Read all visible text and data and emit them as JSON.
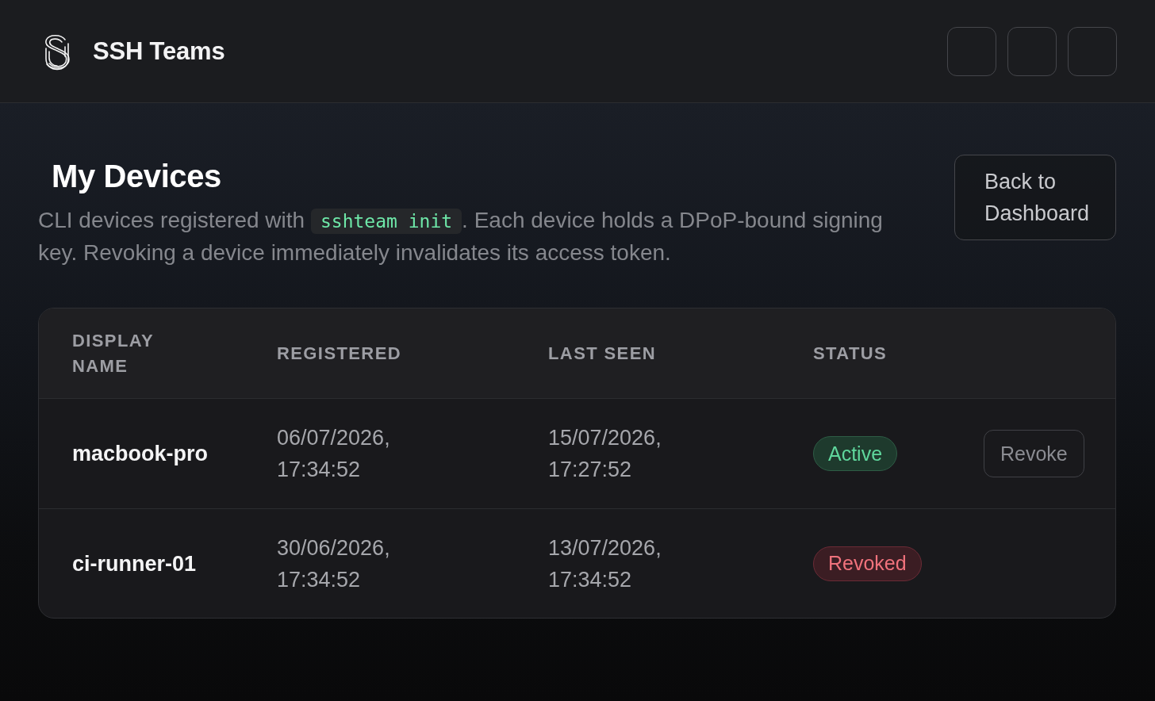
{
  "header": {
    "title": "SSH Teams",
    "icon_buttons": [
      {
        "kind": "blank"
      },
      {
        "kind": "blank"
      },
      {
        "kind": "blank"
      }
    ]
  },
  "page": {
    "heading": "My Devices",
    "description": {
      "before": "CLI devices registered with ",
      "code": "sshteam init",
      "after": ". Each device holds a DPoP-bound signing key. Revoking a device immediately invalidates its access token."
    },
    "back_button": "Back to Dashboard"
  },
  "table": {
    "columns": [
      "DISPLAY NAME",
      "REGISTERED",
      "LAST SEEN",
      "STATUS"
    ],
    "rows": [
      {
        "display_name": "macbook-pro",
        "registered": "06/07/2026, 17:34:52",
        "last_seen": "15/07/2026, 17:27:52",
        "status": {
          "label": "Active",
          "kind": "active"
        },
        "action": "Revoke"
      },
      {
        "display_name": "ci-runner-01",
        "registered": "30/06/2026, 17:34:52",
        "last_seen": "13/07/2026, 17:34:52",
        "status": {
          "label": "Revoked",
          "kind": "revoked"
        }
      }
    ]
  }
}
